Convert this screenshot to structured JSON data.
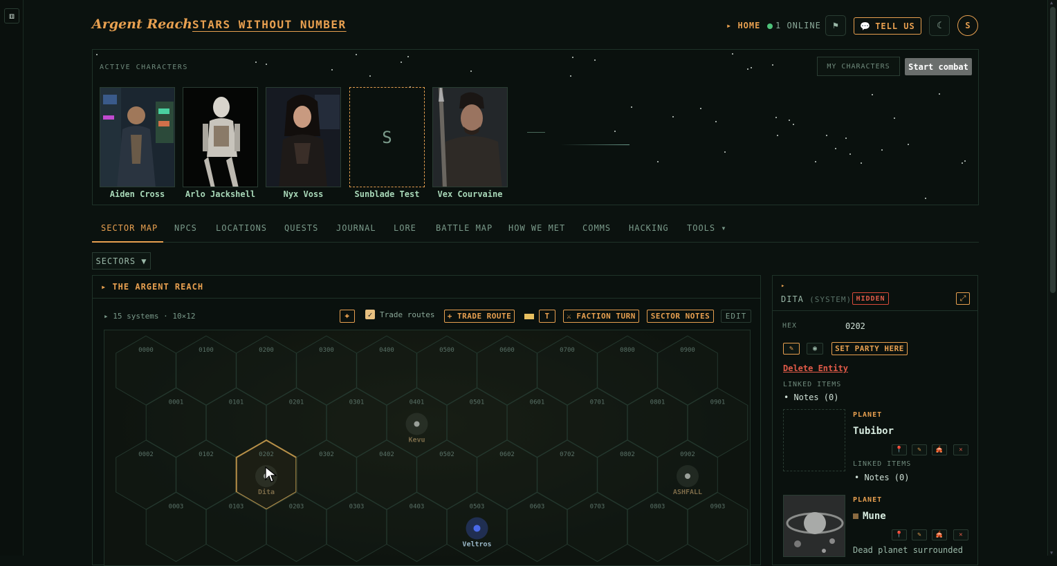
{
  "header": {
    "brand": "Argent Reach",
    "separator": "·",
    "game_title": "STARS WITHOUT NUMBER",
    "home_label": "▸ HOME",
    "online_label": "1 ONLINE",
    "tell_us_label": "TELL US",
    "avatar_initial": "S"
  },
  "characters": {
    "section_title": "ACTIVE CHARACTERS",
    "my_characters_label": "MY CHARACTERS",
    "start_combat_label": "Start combat",
    "items": [
      {
        "name": "Aiden Cross"
      },
      {
        "name": "Arlo Jackshell"
      },
      {
        "name": "Nyx Voss"
      },
      {
        "name": "Sunblade Test",
        "placeholder_initial": "S"
      },
      {
        "name": "Vex Courvaine"
      }
    ]
  },
  "tabs": [
    {
      "label": "SECTOR MAP",
      "active": true
    },
    {
      "label": "NPCS"
    },
    {
      "label": "LOCATIONS"
    },
    {
      "label": "QUESTS"
    },
    {
      "label": "JOURNAL"
    },
    {
      "label": "LORE"
    },
    {
      "label": "BATTLE MAP"
    },
    {
      "label": "HOW WE MET"
    },
    {
      "label": "COMMS"
    },
    {
      "label": "HACKING"
    },
    {
      "label": "TOOLS ▾"
    }
  ],
  "sectors_label": "SECTORS ▼",
  "map": {
    "title": "▸ THE ARGENT REACH",
    "info": "▸ 15 systems · 10×12",
    "trade_routes_label": "Trade routes",
    "trade_routes_checked": true,
    "trade_route_btn": "+ TRADE ROUTE",
    "t_btn": "T",
    "faction_turn_btn": "⚔ FACTION TURN",
    "sector_notes_btn": "SECTOR NOTES",
    "edit_btn": "EDIT",
    "hex_rows": [
      [
        "0000",
        "0100",
        "0200",
        "0300",
        "0400",
        "0500",
        "0600",
        "0700",
        "0800",
        "0900"
      ],
      [
        "0001",
        "0101",
        "0201",
        "0301",
        "0401",
        "0501",
        "0601",
        "0701",
        "0801",
        "0901"
      ],
      [
        "0002",
        "0102",
        "0202",
        "0302",
        "0402",
        "0502",
        "0602",
        "0702",
        "0802",
        "0902"
      ],
      [
        "0003",
        "0103",
        "0203",
        "0303",
        "0403",
        "0503",
        "0603",
        "0703",
        "0803",
        "0903"
      ]
    ],
    "systems": [
      {
        "name": "Kevu",
        "hex": "0401"
      },
      {
        "name": "Dita",
        "hex": "0202",
        "selected": true
      },
      {
        "name": "ASHFALL",
        "hex": "0902"
      },
      {
        "name": "Veltros",
        "hex": "0503"
      }
    ]
  },
  "detail": {
    "name": "DITA",
    "kind": "(SYSTEM)",
    "status": "HIDDEN",
    "hex_label": "HEX",
    "hex_value": "0202",
    "set_party_label": "SET PARTY HERE",
    "delete_label": "Delete Entity",
    "linked_items_label": "LINKED ITEMS",
    "notes_label": "Notes (0)",
    "planets": [
      {
        "type": "PLANET",
        "name": "Tubibor",
        "linked_label": "LINKED ITEMS",
        "notes": "Notes (0)"
      },
      {
        "type": "PLANET",
        "name": "Mune",
        "description": "Dead planet surrounded"
      }
    ]
  },
  "colors": {
    "accent": "#e8a050",
    "danger": "#e05a48",
    "online": "#4ec27a"
  }
}
